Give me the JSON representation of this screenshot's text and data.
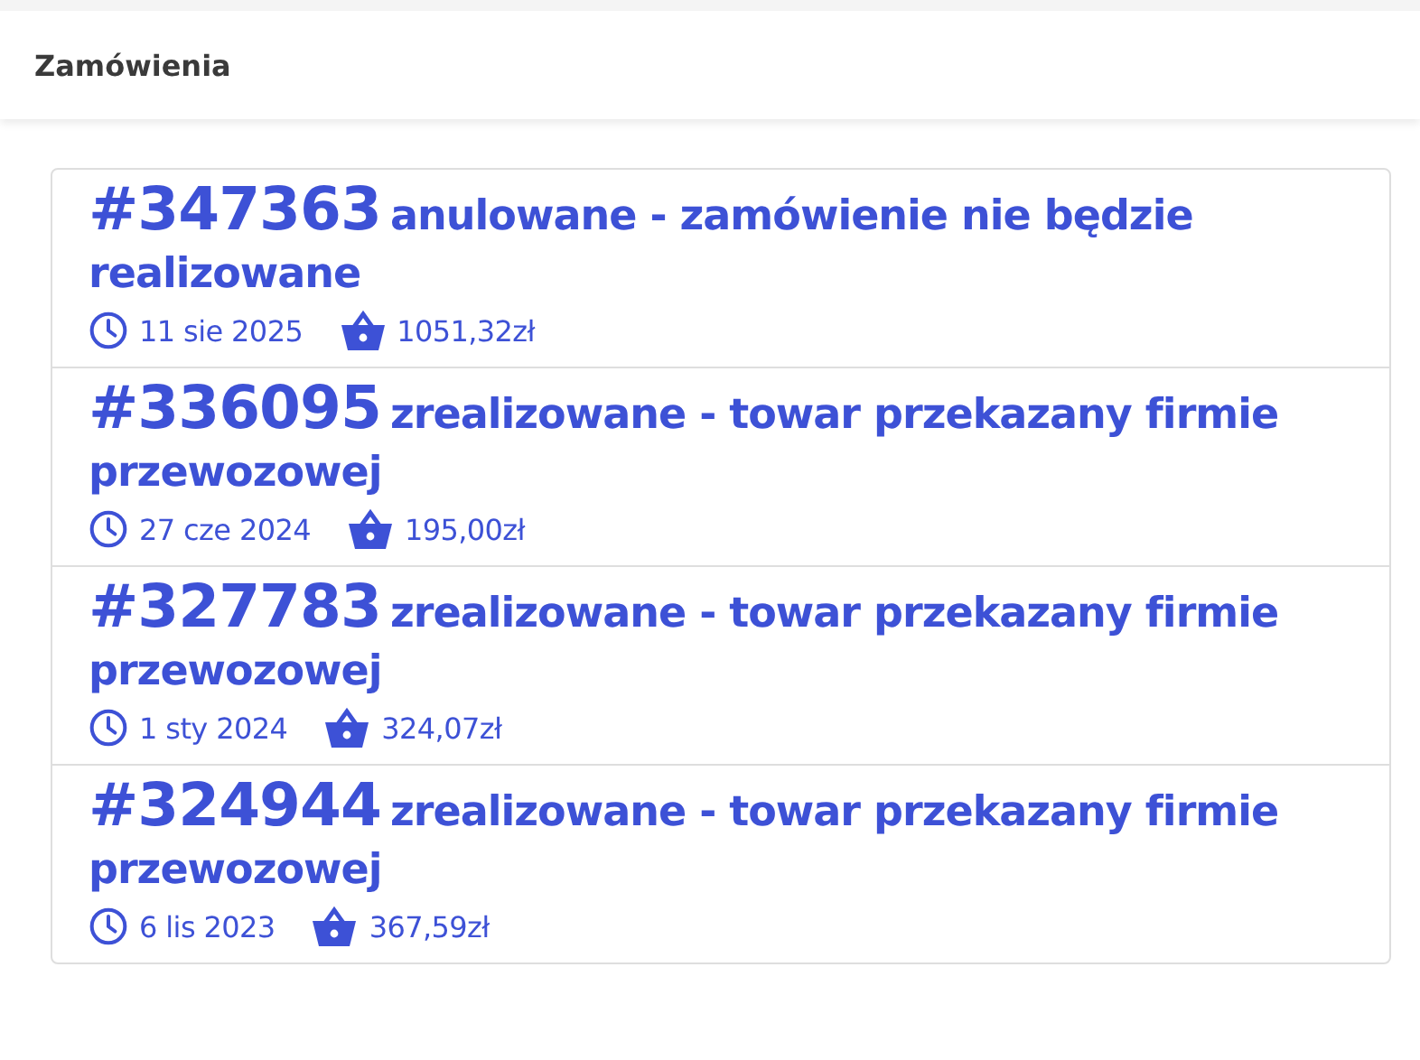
{
  "header": {
    "title": "Zamówienia"
  },
  "orders": [
    {
      "number": "#347363",
      "status": "anulowane - zamówienie nie będzie realizowane",
      "date": "11 sie 2025",
      "total": "1051,32zł"
    },
    {
      "number": "#336095",
      "status": "zrealizowane - towar przekazany firmie przewozowej",
      "date": "27 cze 2024",
      "total": "195,00zł"
    },
    {
      "number": "#327783",
      "status": "zrealizowane - towar przekazany firmie przewozowej",
      "date": "1 sty 2024",
      "total": "324,07zł"
    },
    {
      "number": "#324944",
      "status": "zrealizowane - towar przekazany firmie przewozowej",
      "date": "6 lis 2023",
      "total": "367,59zł"
    }
  ]
}
